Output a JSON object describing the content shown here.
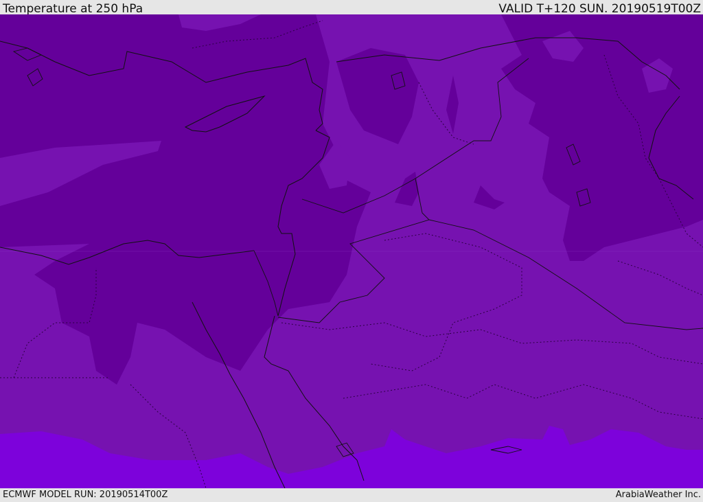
{
  "header": {
    "title": "Temperature at 250 hPa",
    "valid": "VALID T+120 SUN. 20190519T00Z"
  },
  "footer": {
    "model_run": "ECMWF MODEL RUN: 20190514T00Z",
    "credit": "ArabiaWeather Inc."
  },
  "colors": {
    "dark": "#64009a",
    "medium": "#7612b0",
    "bright": "#7d02db",
    "border": "#111111"
  }
}
